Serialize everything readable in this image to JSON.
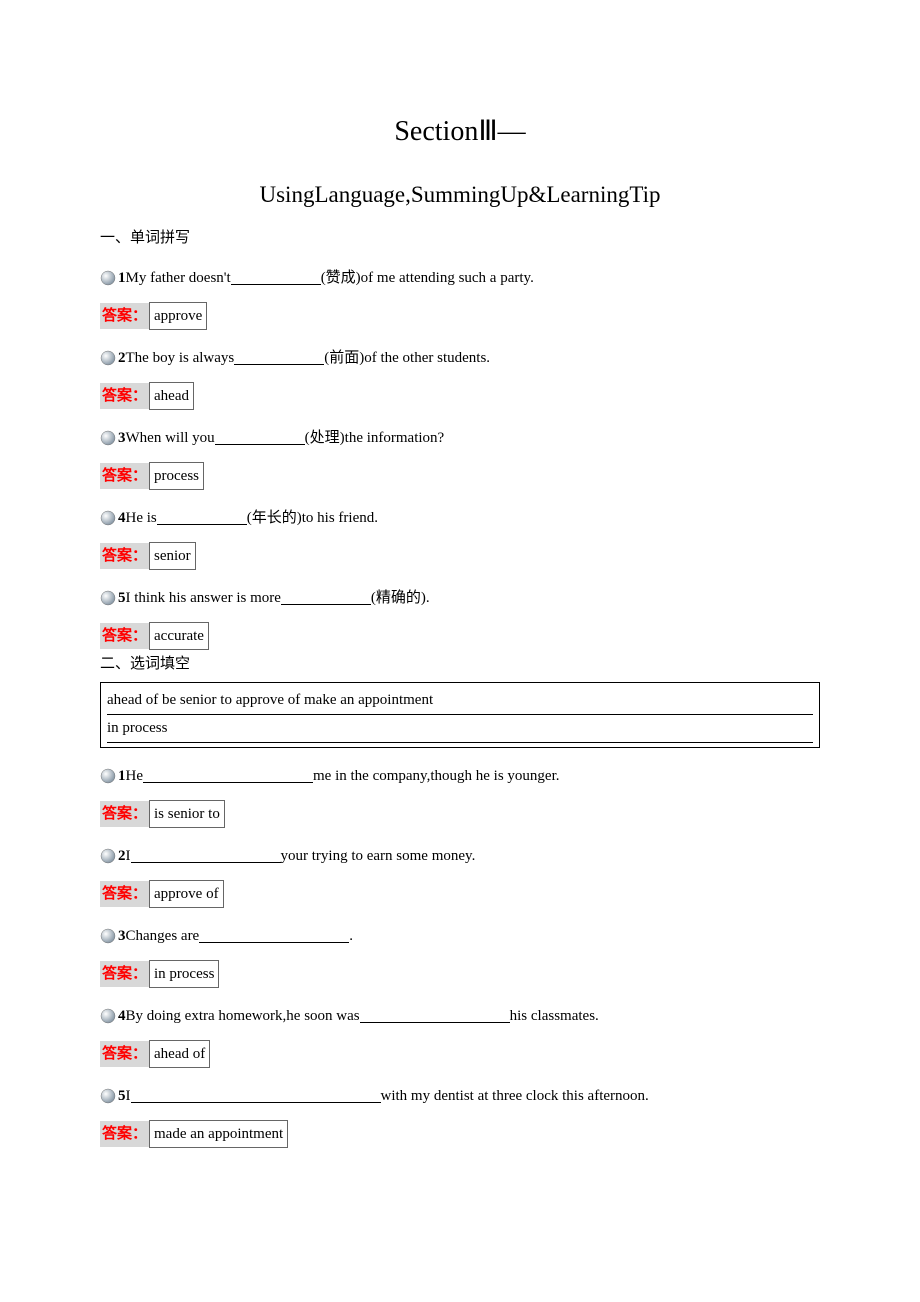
{
  "title": {
    "line1": "SectionⅢ—",
    "line2": "UsingLanguage,SummingUp&LearningTip"
  },
  "section1": {
    "heading": "一、单词拼写",
    "answer_label": "答案：",
    "q1": {
      "num": "1",
      "pre": "My father doesn't ",
      "post": "(赞成)of me attending such a party.",
      "answer": "approve"
    },
    "q2": {
      "num": "2",
      "pre": "The boy is always ",
      "post": "(前面)of the other students.",
      "answer": "ahead"
    },
    "q3": {
      "num": "3",
      "pre": "When will you ",
      "post": "(处理)the information?",
      "answer": "process"
    },
    "q4": {
      "num": "4",
      "pre": "He is ",
      "post": "(年长的)to his friend.",
      "answer": "senior"
    },
    "q5": {
      "num": "5",
      "pre": "I think his answer is more ",
      "post": "(精确的).",
      "answer": "accurate"
    }
  },
  "section2": {
    "heading": "二、选词填空",
    "wordbank_line1": "ahead of   be senior to   approve of   make an appointment",
    "wordbank_line2": "in process",
    "answer_label": "答案：",
    "q1": {
      "num": "1",
      "pre": "He ",
      "post": "me in the company,though he is younger.",
      "answer": "is senior to"
    },
    "q2": {
      "num": "2",
      "pre": "I ",
      "post": "your trying to earn some money.",
      "answer": "approve of"
    },
    "q3": {
      "num": "3",
      "pre": "Changes are",
      "post": ".",
      "answer": "in process"
    },
    "q4": {
      "num": "4",
      "pre": "By doing extra homework,he soon was ",
      "post": "his classmates.",
      "answer": "ahead of"
    },
    "q5": {
      "num": "5",
      "pre": "I ",
      "post": "with my dentist at three clock this afternoon.",
      "answer": "made an appointment"
    }
  }
}
